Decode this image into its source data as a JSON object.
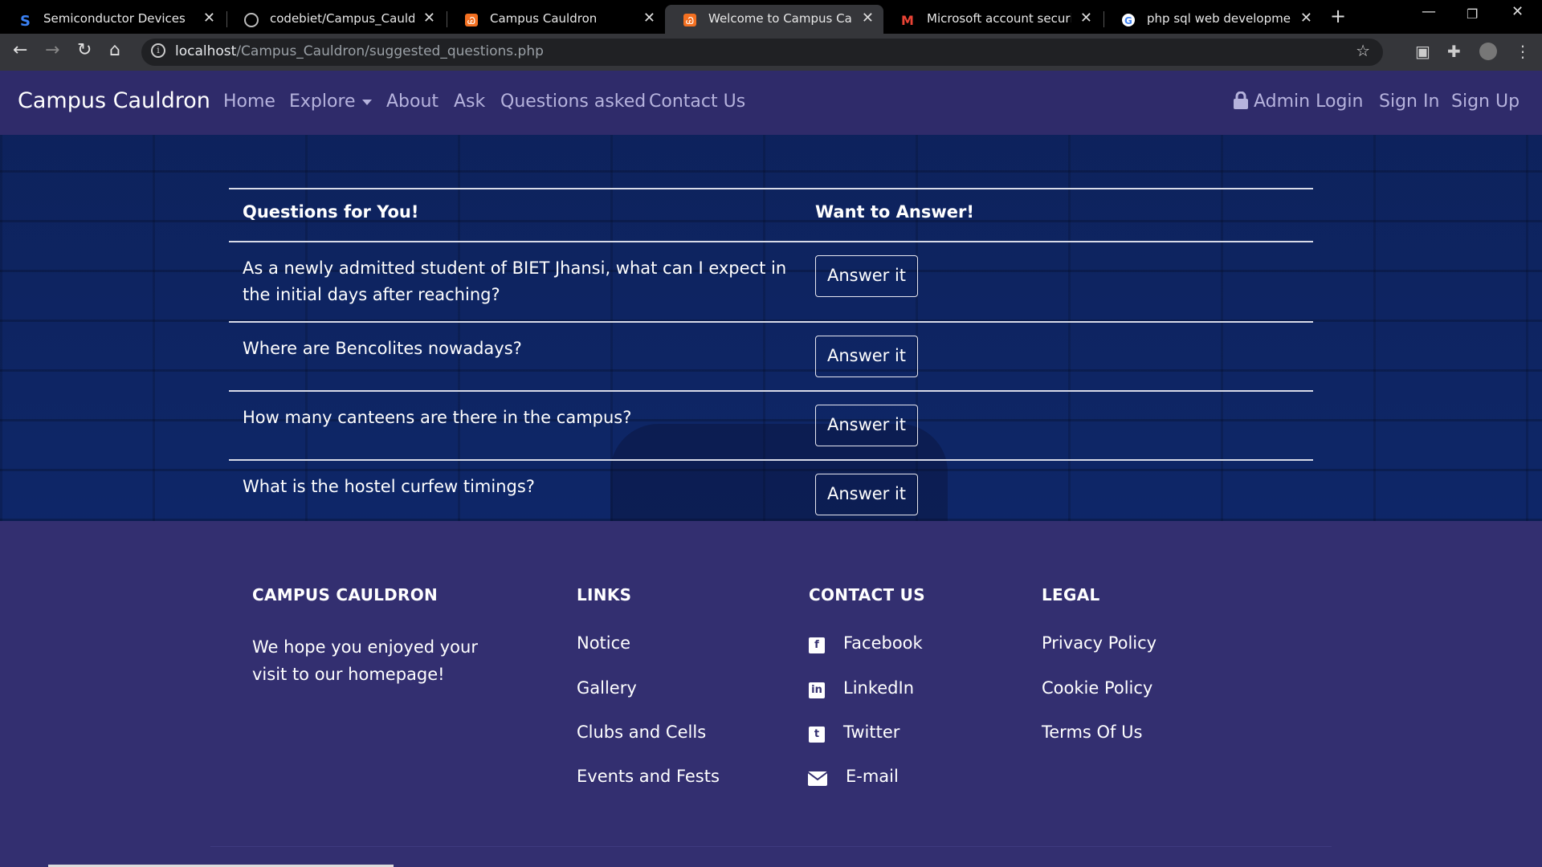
{
  "browser": {
    "tabs": [
      {
        "title": "Semiconductor Devices and C",
        "icon": "s-logo-icon"
      },
      {
        "title": "codebiet/Campus_Cauldron:",
        "icon": "github-icon"
      },
      {
        "title": "Campus Cauldron",
        "icon": "xampp-icon"
      },
      {
        "title": "Welcome to Campus Cauldro",
        "icon": "xampp-icon"
      },
      {
        "title": "Microsoft account security c",
        "icon": "gmail-icon"
      },
      {
        "title": "php sql web development gr",
        "icon": "google-icon"
      }
    ],
    "url_host": "localhost",
    "url_path": "/Campus_Cauldron/suggested_questions.php"
  },
  "nav": {
    "brand": "Campus Cauldron",
    "links": [
      "Home",
      "Explore",
      "About",
      "Ask",
      "Questions asked",
      "Contact Us"
    ],
    "admin_login": "Admin Login",
    "sign_in": "Sign In",
    "sign_up": "Sign Up"
  },
  "questions": {
    "col1": "Questions for You!",
    "col2": "Want to Answer!",
    "button_label": "Answer it",
    "items": [
      "As a newly admitted student of BIET Jhansi, what can I expect in the initial days after reaching?",
      "Where are Bencolites nowadays?",
      "How many canteens are there in the campus?",
      "What is the hostel curfew timings?"
    ]
  },
  "footer": {
    "about_heading": "CAMPUS CAULDRON",
    "about_text": "We hope you enjoyed your visit to our homepage!",
    "links_heading": "LINKS",
    "links": [
      "Notice",
      "Gallery",
      "Clubs and Cells",
      "Events and Fests"
    ],
    "contact_heading": "CONTACT US",
    "contact": [
      {
        "label": "Facebook",
        "icon": "facebook-icon"
      },
      {
        "label": "LinkedIn",
        "icon": "linkedin-icon"
      },
      {
        "label": "Twitter",
        "icon": "twitter-icon"
      },
      {
        "label": "E-mail",
        "icon": "envelope-icon"
      }
    ],
    "legal_heading": "LEGAL",
    "legal": [
      "Privacy Policy",
      "Cookie Policy",
      "Terms Of Us"
    ]
  }
}
